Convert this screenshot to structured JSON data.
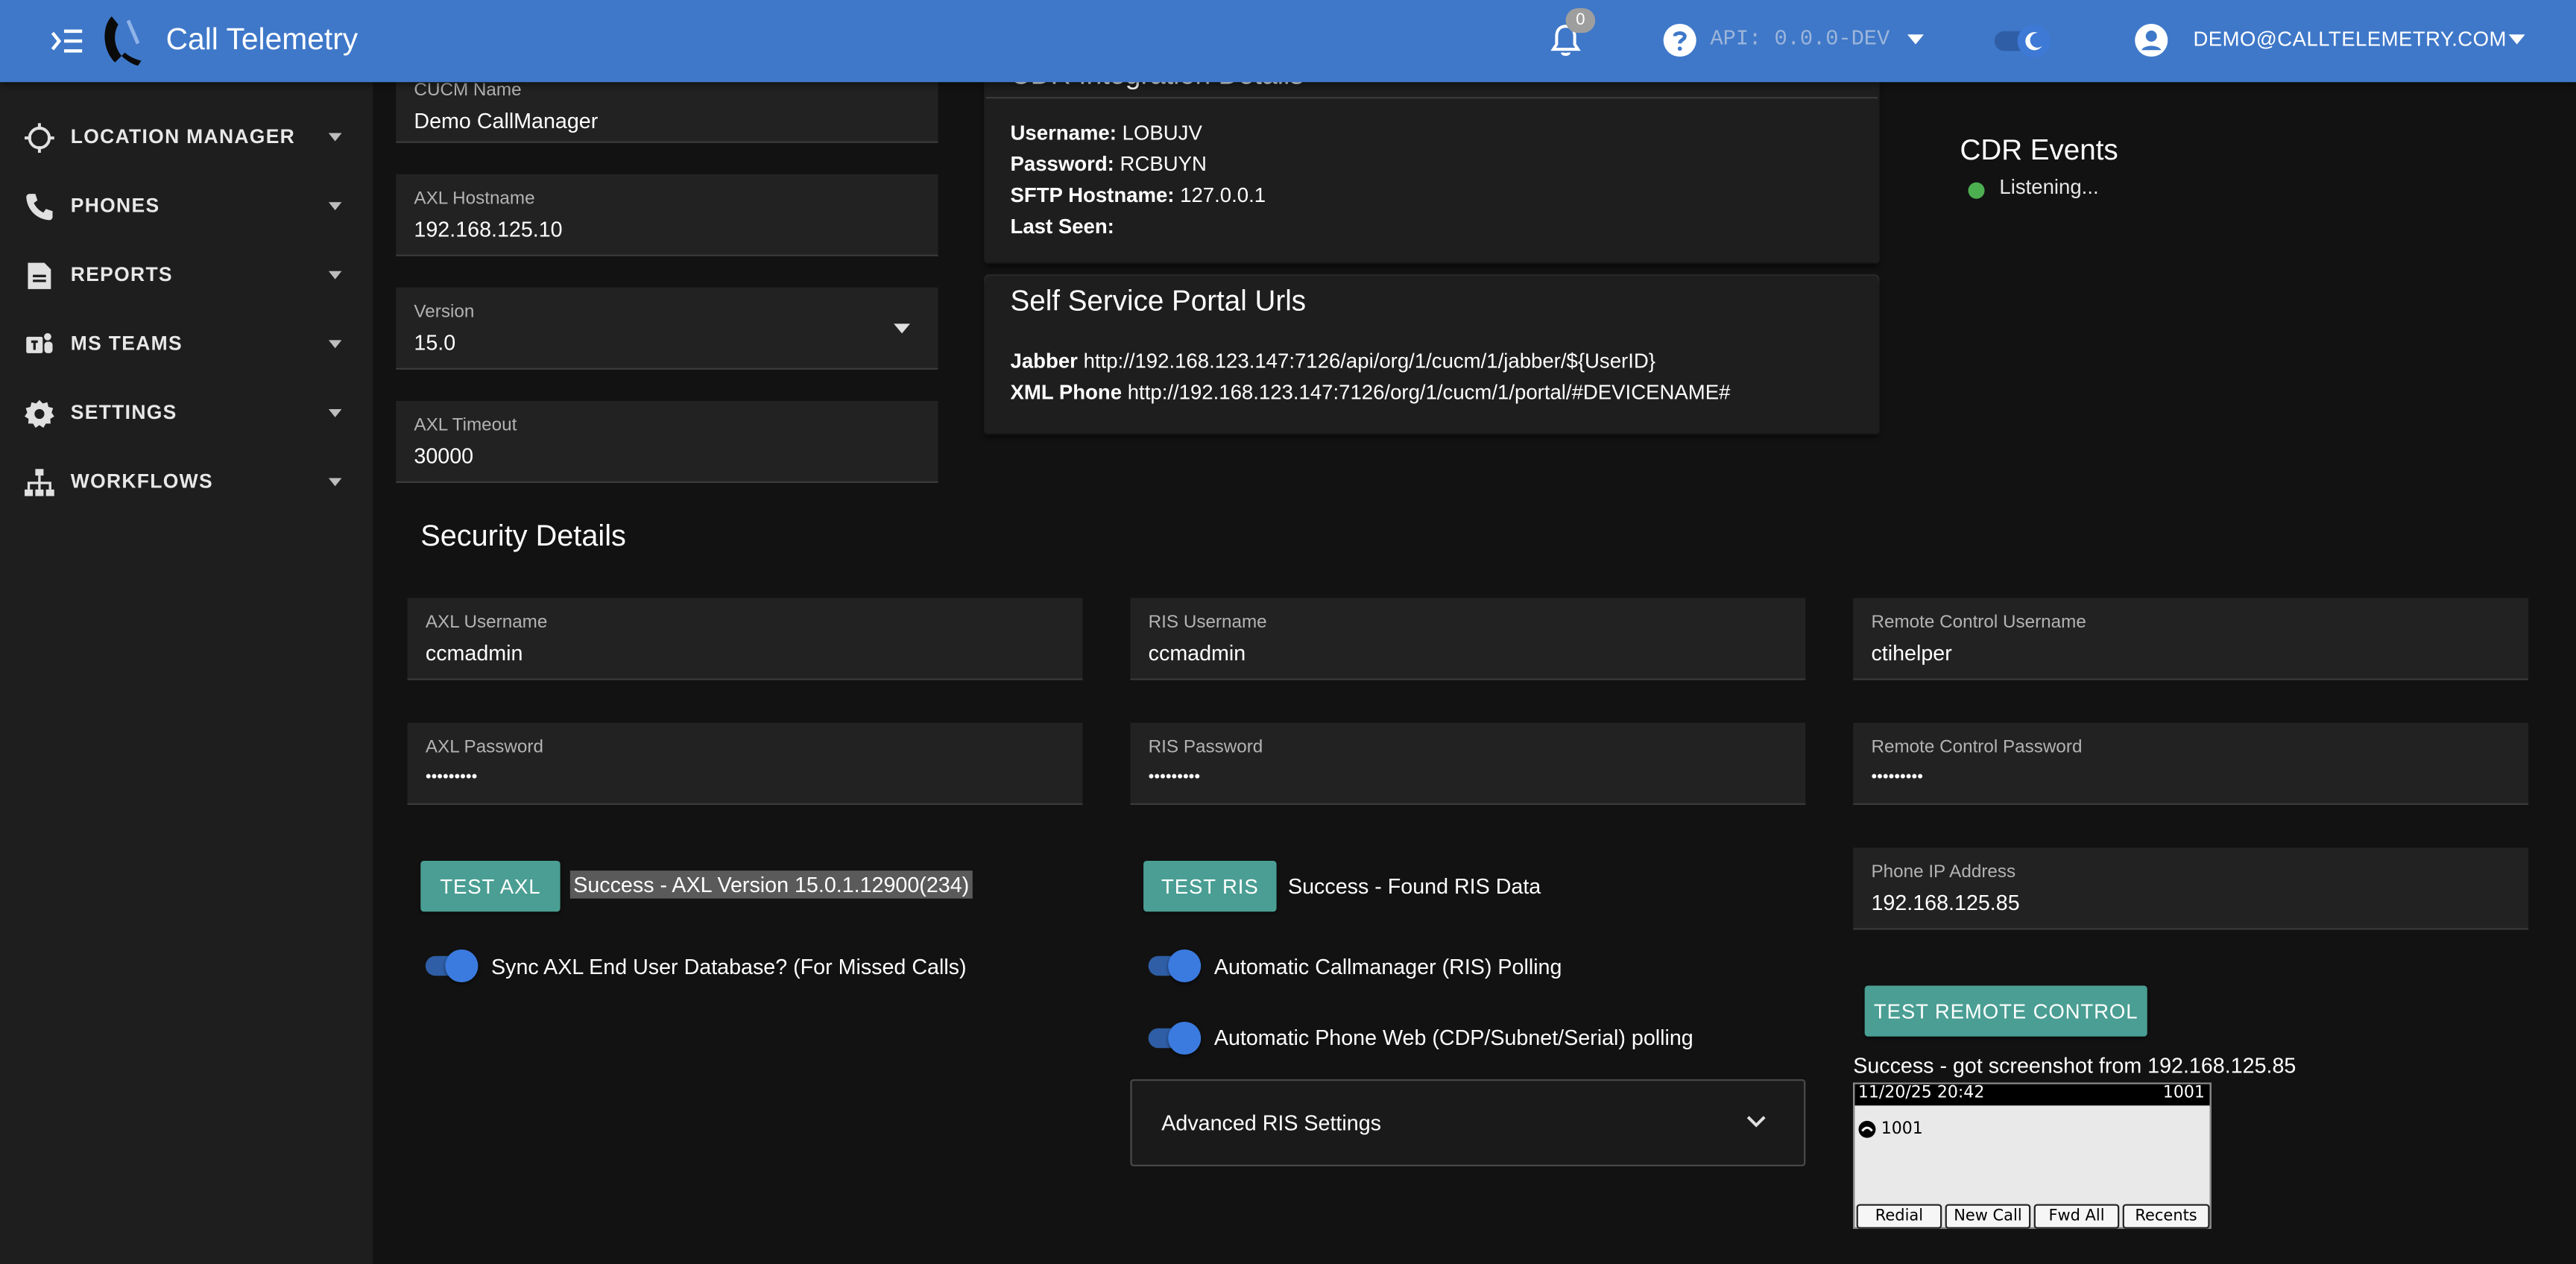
{
  "header": {
    "app_title": "Call Telemetry",
    "notification_count": "0",
    "api_label": "API: 0.0.0-DEV",
    "account": "DEMO@CALLTELEMETRY.COM"
  },
  "sidebar": {
    "items": [
      {
        "label": "LOCATION MANAGER",
        "icon": "crosshair-icon"
      },
      {
        "label": "PHONES",
        "icon": "phone-icon"
      },
      {
        "label": "REPORTS",
        "icon": "report-icon"
      },
      {
        "label": "MS TEAMS",
        "icon": "teams-icon"
      },
      {
        "label": "SETTINGS",
        "icon": "gear-icon"
      },
      {
        "label": "WORKFLOWS",
        "icon": "sitemap-icon"
      }
    ]
  },
  "cucm": {
    "name_label": "CUCM Name",
    "name_value": "Demo CallManager",
    "hostname_label": "AXL Hostname",
    "hostname_value": "192.168.125.10",
    "version_label": "Version",
    "version_value": "15.0",
    "timeout_label": "AXL Timeout",
    "timeout_value": "30000"
  },
  "cdr_card": {
    "title": "CDR Integration Details",
    "username_label": "Username:",
    "username_value": "LOBUJV",
    "password_label": "Password:",
    "password_value": "RCBUYN",
    "sftp_label": "SFTP Hostname:",
    "sftp_value": "127.0.0.1",
    "last_seen_label": "Last Seen:",
    "last_seen_value": ""
  },
  "portal_card": {
    "title": "Self Service Portal Urls",
    "jabber_label": "Jabber",
    "jabber_url": "http://192.168.123.147:7126/api/org/1/cucm/1/jabber/${UserID}",
    "xml_label": "XML Phone",
    "xml_url": "http://192.168.123.147:7126/org/1/cucm/1/portal/#DEVICENAME#"
  },
  "cdr_events": {
    "title": "CDR Events",
    "status": "Listening...",
    "status_color": "#4caf50"
  },
  "security": {
    "title": "Security Details",
    "axl_user_label": "AXL Username",
    "axl_user_value": "ccmadmin",
    "ris_user_label": "RIS Username",
    "ris_user_value": "ccmadmin",
    "rc_user_label": "Remote Control Username",
    "rc_user_value": "ctihelper",
    "axl_pass_label": "AXL Password",
    "axl_pass_value": "•••••••••",
    "ris_pass_label": "RIS Password",
    "ris_pass_value": "•••••••••",
    "rc_pass_label": "Remote Control Password",
    "rc_pass_value": "•••••••••",
    "test_axl": "TEST AXL",
    "axl_result": "Success - AXL Version 15.0.1.12900(234)",
    "test_ris": "TEST RIS",
    "ris_result": "Success - Found RIS Data",
    "phone_ip_label": "Phone IP Address",
    "phone_ip_value": "192.168.125.85",
    "sync_axl_label": "Sync AXL End User Database? (For Missed Calls)",
    "ris_polling_label": "Automatic Callmanager (RIS) Polling",
    "web_polling_label": "Automatic Phone Web (CDP/Subnet/Serial) polling",
    "advanced_ris": "Advanced RIS Settings",
    "test_remote": "TEST REMOTE CONTROL",
    "remote_result": "Success - got screenshot from 192.168.125.85"
  },
  "phone_screen": {
    "datetime": "11/20/25 20:42",
    "ext_top": "1001",
    "line": "1001",
    "softkeys": [
      "Redial",
      "New Call",
      "Fwd All",
      "Recents"
    ]
  },
  "colors": {
    "topbar": "#3f78c9",
    "accent_teal": "#4a9e93",
    "switch_on": "#3b7be0"
  }
}
